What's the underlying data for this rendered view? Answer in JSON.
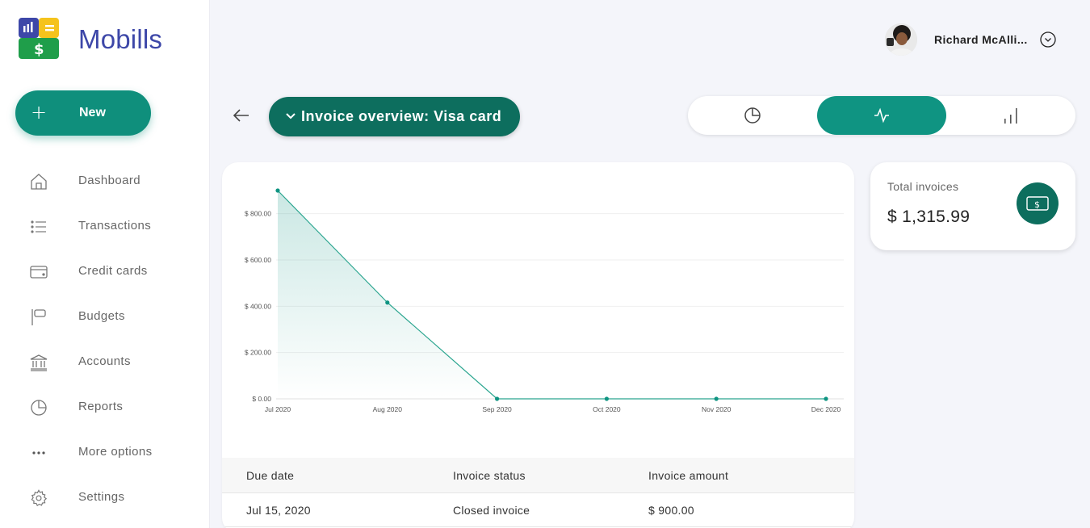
{
  "app": {
    "brand": "Mobills"
  },
  "sidebar": {
    "new_label": "New",
    "items": [
      {
        "label": "Dashboard",
        "icon": "home-icon"
      },
      {
        "label": "Transactions",
        "icon": "list-icon"
      },
      {
        "label": "Credit cards",
        "icon": "credit-card-icon"
      },
      {
        "label": "Budgets",
        "icon": "flag-icon"
      },
      {
        "label": "Accounts",
        "icon": "bank-icon"
      },
      {
        "label": "Reports",
        "icon": "pie-chart-icon"
      },
      {
        "label": "More options",
        "icon": "more-dots-icon"
      },
      {
        "label": "Settings",
        "icon": "gear-icon"
      }
    ]
  },
  "header": {
    "user_name": "Richard McAlli...",
    "page_title": "Invoice overview: Visa card",
    "view_options": [
      "pie-chart-icon",
      "line-chart-icon",
      "bar-chart-icon"
    ],
    "active_view": 1
  },
  "summary": {
    "label": "Total invoices",
    "value": "$ 1,315.99"
  },
  "colors": {
    "accent": "#0f9482",
    "accent_dark": "#0d6e5e",
    "brand": "#3d47a8"
  },
  "chart_data": {
    "type": "area",
    "categories": [
      "Jul 2020",
      "Aug 2020",
      "Sep 2020",
      "Oct 2020",
      "Nov 2020",
      "Dec 2020"
    ],
    "values": [
      900.0,
      415.99,
      0,
      0,
      0,
      0
    ],
    "y_ticks": [
      "$ 0.00",
      "$ 200.00",
      "$ 400.00",
      "$ 600.00",
      "$ 800.00"
    ],
    "ylim": [
      0,
      900
    ],
    "grid": true
  },
  "table": {
    "columns": [
      "Due date",
      "Invoice status",
      "Invoice amount"
    ],
    "rows": [
      [
        "Jul 15, 2020",
        "Closed invoice",
        "$ 900.00"
      ]
    ]
  }
}
